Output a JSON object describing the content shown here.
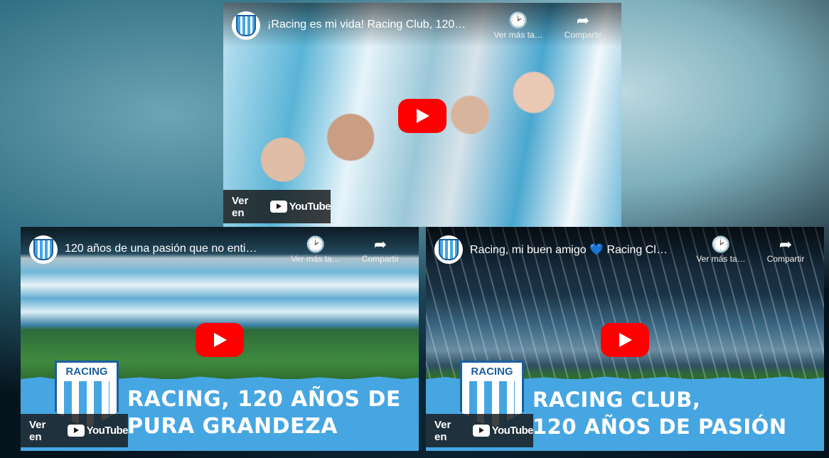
{
  "videos": [
    {
      "title": "¡Racing es mi vida! Racing Club, 120…",
      "watch_later_label": "Ver más ta…",
      "share_label": "Compartir",
      "watch_on_label": "Ver en",
      "youtube_word": "YouTube",
      "promo_line_1": "",
      "promo_line_2": ""
    },
    {
      "title": "120 años de una pasión que no enti…",
      "watch_later_label": "Ver más ta…",
      "share_label": "Compartir",
      "watch_on_label": "Ver en",
      "youtube_word": "YouTube",
      "crest_text": "RACING",
      "promo_line_1": "RACING, 120 AÑOS DE",
      "promo_line_2": "PURA GRANDEZA"
    },
    {
      "title": "Racing, mi buen amigo 💙 Racing Cl…",
      "watch_later_label": "Ver más ta…",
      "share_label": "Compartir",
      "watch_on_label": "Ver en",
      "youtube_word": "YouTube",
      "crest_text": "RACING",
      "promo_line_1": "RACING CLUB,",
      "promo_line_2": "120 AÑOS DE PASIÓN"
    }
  ],
  "icons": {
    "watch_later": "clock-icon",
    "share": "share-arrow-icon",
    "play": "play-icon",
    "youtube": "youtube-logo-icon"
  },
  "colors": {
    "youtube_red": "#ff0000",
    "racing_blue": "#46a6e2",
    "racing_dark_blue": "#1a5fa0"
  }
}
